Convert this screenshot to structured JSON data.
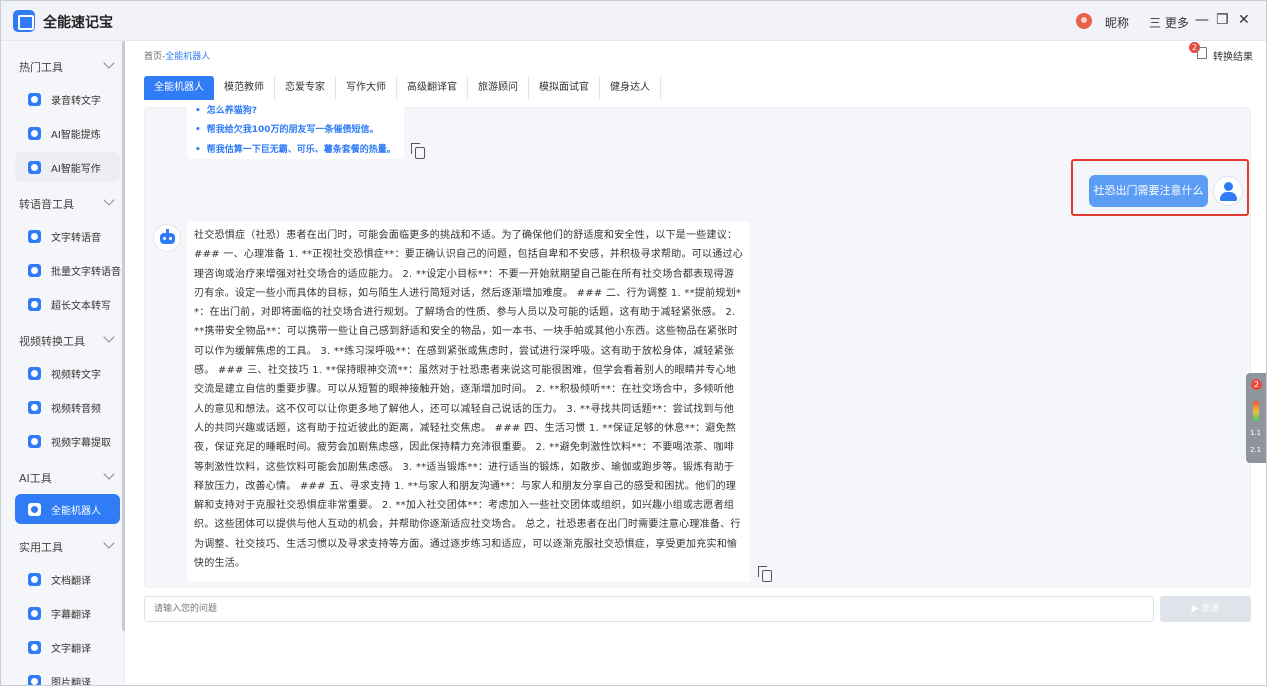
{
  "app": {
    "title": "全能速记宝"
  },
  "titlebar": {
    "nickname": "昵称",
    "more": "三 更多",
    "min": "—",
    "restore": "❐",
    "close": "✕"
  },
  "sidebar": {
    "groups": [
      {
        "label": "热门工具",
        "items": [
          "录音转文字",
          "AI智能提炼",
          "AI智能写作"
        ]
      },
      {
        "label": "转语音工具",
        "items": [
          "文字转语音",
          "批量文字转语音",
          "超长文本转写"
        ]
      },
      {
        "label": "视频转换工具",
        "items": [
          "视频转文字",
          "视频转音频",
          "视频字幕提取"
        ]
      },
      {
        "label": "AI工具",
        "items": [
          "全能机器人"
        ]
      },
      {
        "label": "实用工具",
        "items": [
          "文档翻译",
          "字幕翻译",
          "文字翻译",
          "图片翻译"
        ]
      }
    ],
    "active_item": "全能机器人"
  },
  "breadcrumb": {
    "home": "首页",
    "sep": "-",
    "current": "全能机器人"
  },
  "convert_results": {
    "badge": "2",
    "label": "转换结果"
  },
  "tabs": [
    "全能机器人",
    "模范教师",
    "恋爱专家",
    "写作大师",
    "高级翻译官",
    "旅游顾问",
    "模拟面试官",
    "健身达人"
  ],
  "suggestions": [
    "怎么养猫狗?",
    "帮我给欠我100万的朋友写一条催债短信。",
    "帮我估算一下巨无霸、可乐、薯条套餐的热量。"
  ],
  "user_message": "社恐出门需要注意什么",
  "bot_message": "社交恐惧症（社恐）患者在出门时，可能会面临更多的挑战和不适。为了确保他们的舒适度和安全性，以下是一些建议： ### 一、心理准备 1. **正视社交恐惧症**：要正确认识自己的问题，包括自卑和不安感，并积极寻求帮助。可以通过心理咨询或治疗来增强对社交场合的适应能力。 2. **设定小目标**：不要一开始就期望自己能在所有社交场合都表现得游刃有余。设定一些小而具体的目标，如与陌生人进行简短对话，然后逐渐增加难度。 ### 二、行为调整 1. **提前规划**：在出门前，对即将面临的社交场合进行规划。了解场合的性质、参与人员以及可能的话题，这有助于减轻紧张感。 2. **携带安全物品**：可以携带一些让自己感到舒适和安全的物品，如一本书、一块手帕或其他小东西。这些物品在紧张时可以作为缓解焦虑的工具。 3. **练习深呼吸**：在感到紧张或焦虑时，尝试进行深呼吸。这有助于放松身体，减轻紧张感。 ### 三、社交技巧 1. **保持眼神交流**：虽然对于社恐患者来说这可能很困难，但学会看着别人的眼睛并专心地交流是建立自信的重要步骤。可以从短暂的眼神接触开始，逐渐增加时间。 2. **积极倾听**：在社交场合中，多倾听他人的意见和想法。这不仅可以让你更多地了解他人，还可以减轻自己说话的压力。 3. **寻找共同话题**：尝试找到与他人的共同兴趣或话题，这有助于拉近彼此的距离，减轻社交焦虑。 ### 四、生活习惯 1. **保证足够的休息**：避免熬夜，保证充足的睡眠时间。疲劳会加剧焦虑感，因此保持精力充沛很重要。 2. **避免刺激性饮料**：不要喝浓茶、咖啡等刺激性饮料，这些饮料可能会加剧焦虑感。 3. **适当锻炼**：进行适当的锻炼，如散步、瑜伽或跑步等。锻炼有助于释放压力，改善心情。 ### 五、寻求支持 1. **与家人和朋友沟通**：与家人和朋友分享自己的感受和困扰。他们的理解和支持对于克服社交恐惧症非常重要。 2. **加入社交团体**：考虑加入一些社交团体或组织，如兴趣小组或志愿者组织。这些团体可以提供与他人互动的机会，并帮助你逐渐适应社交场合。 总之，社恐患者在出门时需要注意心理准备、行为调整、社交技巧、生活习惯以及寻求支持等方面。通过逐步练习和适应，可以逐渐克服社交恐惧症，享受更加充实和愉快的生活。",
  "input": {
    "placeholder": "请输入您的问题",
    "value": ""
  },
  "send": {
    "label": "▶ 发送"
  },
  "float_toolbar": {
    "badge": "2",
    "stat1": "1.1",
    "stat2": "2.1"
  },
  "colors": {
    "accent": "#2f7cf6",
    "highlight_border": "#e23b32",
    "user_bubble": "#5b9df5"
  }
}
